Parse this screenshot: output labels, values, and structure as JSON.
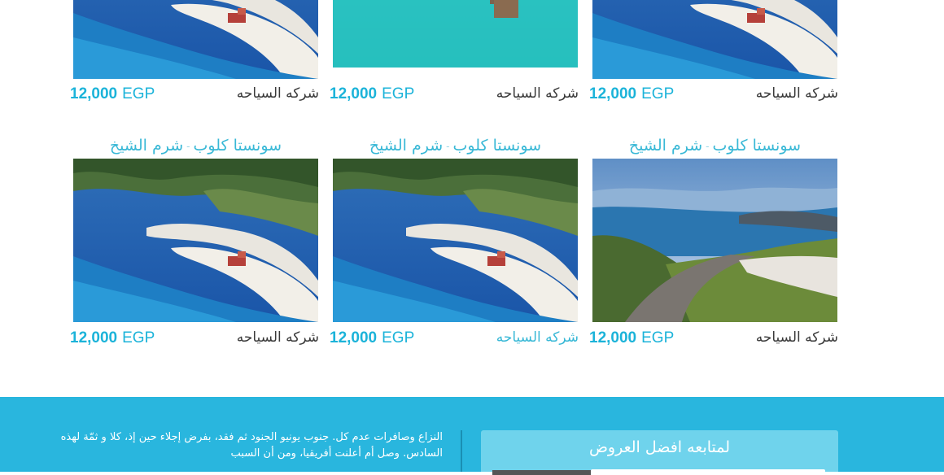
{
  "cards": [
    {
      "title": "",
      "location": "",
      "company": "شركه السياحه",
      "price": "12,000",
      "currency": "EGP",
      "image": "lagoon-beach"
    },
    {
      "title": "",
      "location": "",
      "company": "شركه السياحه",
      "price": "12,000",
      "currency": "EGP",
      "image": "overwater-pier"
    },
    {
      "title": "",
      "location": "",
      "company": "شركه السياحه",
      "price": "12,000",
      "currency": "EGP",
      "image": "lagoon-beach"
    },
    {
      "title": "سونستا كلوب",
      "location": "شرم الشيخ",
      "company": "شركه السياحه",
      "price": "12,000",
      "currency": "EGP",
      "image": "lagoon-beach"
    },
    {
      "title": "سونستا كلوب",
      "location": "شرم الشيخ",
      "company": "شركه السياحه",
      "price": "12,000",
      "currency": "EGP",
      "image": "lagoon-beach"
    },
    {
      "title": "سونستا كلوب",
      "location": "شرم الشيخ",
      "company": "شركه السياحه",
      "price": "12,000",
      "currency": "EGP",
      "image": "coastal-road"
    }
  ],
  "footer": {
    "about_text": "النزاع وصافرات عدم كل. جنوب يونيو الجنود ثم فقد، بفرض إجلاء حين إذ، كلا و ثمّة لهذه السادس. وصل أم أعلنت أفريقيا، ومن أن السبب",
    "subscribe_title": "لمتابعه افضل العروض"
  },
  "colors": {
    "accent": "#38b8d6",
    "price": "#1bb3d9",
    "footer_bg": "#29b6de",
    "subscribe_bg": "#6fd3ec"
  }
}
